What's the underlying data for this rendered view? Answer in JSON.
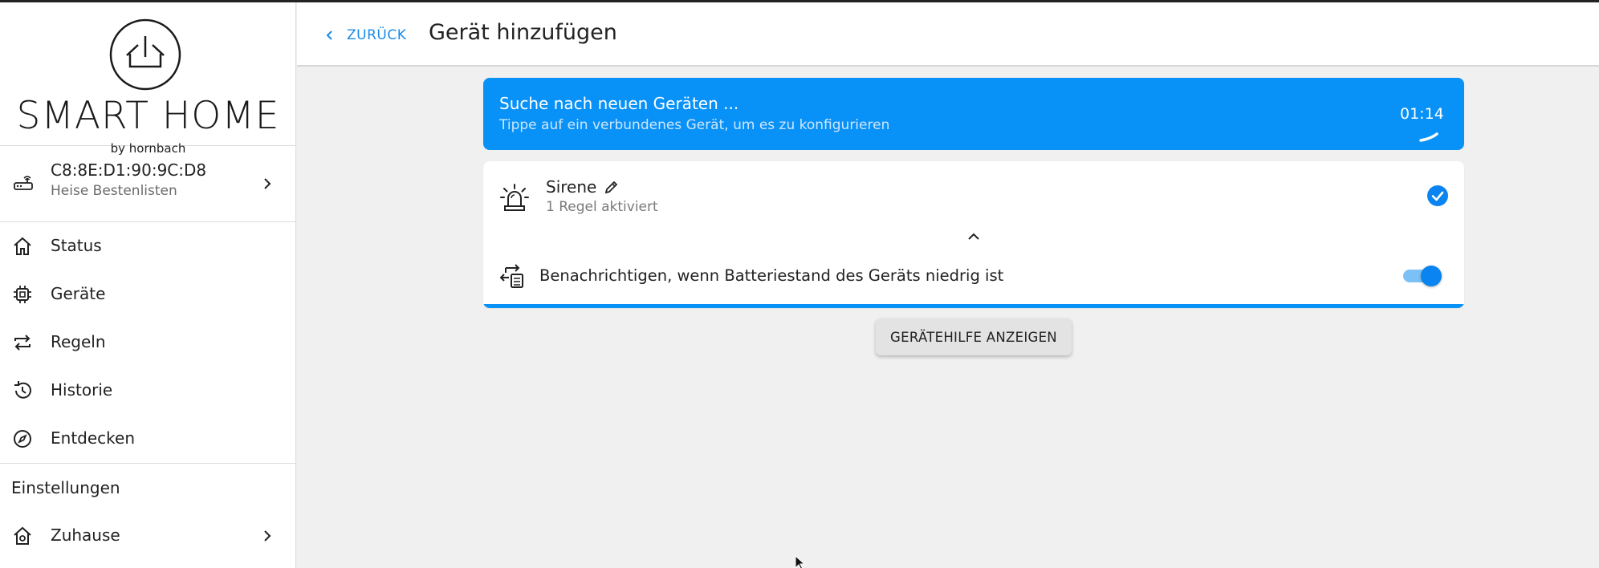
{
  "brand": {
    "title": "SMART HOME",
    "subtitle": "by hornbach"
  },
  "gateway": {
    "title": "C8:8E:D1:90:9C:D8",
    "subtitle": "Heise Bestenlisten",
    "icon": "router-icon"
  },
  "sidebar": {
    "items": [
      {
        "label": "Status",
        "icon": "home-icon"
      },
      {
        "label": "Geräte",
        "icon": "chip-icon"
      },
      {
        "label": "Regeln",
        "icon": "repeat-icon"
      },
      {
        "label": "Historie",
        "icon": "history-icon"
      },
      {
        "label": "Entdecken",
        "icon": "compass-icon"
      }
    ],
    "settings_heading": "Einstellungen",
    "settings_items": [
      {
        "label": "Zuhause",
        "icon": "house-gear-icon"
      }
    ]
  },
  "header": {
    "back_label": "ZURÜCK",
    "title": "Gerät hinzufügen"
  },
  "scan": {
    "title": "Suche nach neuen Geräten ...",
    "subtitle": "Tippe auf ein verbundenes Gerät, um es zu konfigurieren",
    "timer": "01:14"
  },
  "device": {
    "name": "Sirene",
    "status": "1 Regel aktiviert",
    "selected": true,
    "rule": {
      "label": "Benachrichtigen, wenn Batteriestand des Geräts niedrig ist",
      "enabled": true
    }
  },
  "help_button": "GERÄTEHILFE ANZEIGEN",
  "colors": {
    "accent": "#0891f7",
    "link": "#1a8be8",
    "background": "#f0f0f0"
  }
}
